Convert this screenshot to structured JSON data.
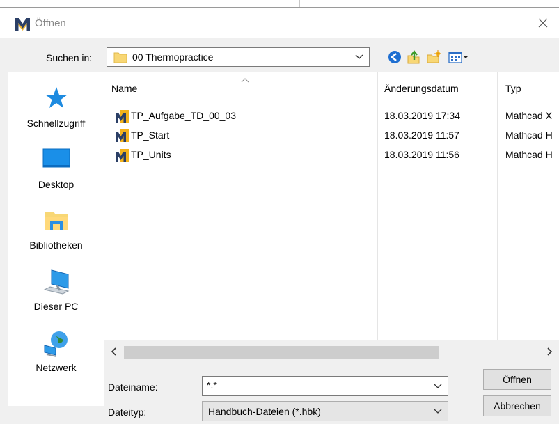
{
  "window": {
    "title": "Öffnen",
    "close_icon": "close-icon"
  },
  "lookin": {
    "label": "Suchen in:",
    "value": "00 Thermopractice"
  },
  "toolbar": {
    "icons": [
      "back-icon",
      "up-folder-icon",
      "new-folder-icon",
      "view-menu-icon"
    ]
  },
  "places": [
    {
      "label": "Schnellzugriff",
      "icon": "quick-access-star-icon"
    },
    {
      "label": "Desktop",
      "icon": "desktop-icon"
    },
    {
      "label": "Bibliotheken",
      "icon": "libraries-icon"
    },
    {
      "label": "Dieser PC",
      "icon": "this-pc-icon"
    },
    {
      "label": "Netzwerk",
      "icon": "network-icon"
    }
  ],
  "columns": {
    "name": "Name",
    "date": "Änderungsdatum",
    "type": "Typ"
  },
  "files": [
    {
      "name": "TP_Aufgabe_TD_00_03",
      "date": "18.03.2019 17:34",
      "type": "Mathcad X"
    },
    {
      "name": "TP_Start",
      "date": "18.03.2019 11:57",
      "type": "Mathcad H"
    },
    {
      "name": "TP_Units",
      "date": "18.03.2019 11:56",
      "type": "Mathcad H"
    }
  ],
  "filename": {
    "label": "Dateiname:",
    "value": "*.*"
  },
  "filetype": {
    "label": "Dateityp:",
    "value": "Handbuch-Dateien (*.hbk)"
  },
  "buttons": {
    "open": "Öffnen",
    "cancel": "Abbrechen"
  },
  "colors": {
    "accent": "#0078d7",
    "folder": "#f8d775"
  }
}
